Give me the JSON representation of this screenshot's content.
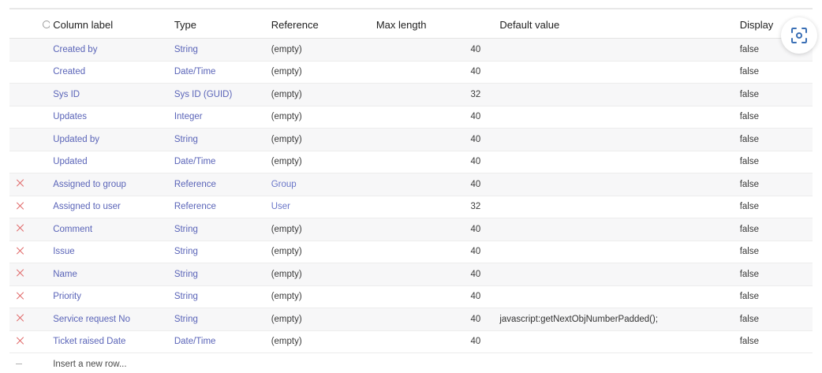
{
  "columns": {
    "label": "Column label",
    "type": "Type",
    "reference": "Reference",
    "max_length": "Max length",
    "default_value": "Default value",
    "display": "Display"
  },
  "icons": {
    "search": "search-icon",
    "delete": "x-icon",
    "insert": "minus-icon",
    "scan": "scan-icon"
  },
  "colors": {
    "link": "#5a64b8",
    "delete": "#e06a6a"
  },
  "rows": [
    {
      "deletable": false,
      "label": "Created by",
      "type": "String",
      "reference": "(empty)",
      "max_length": "40",
      "default_value": "",
      "display": "false"
    },
    {
      "deletable": false,
      "label": "Created",
      "type": "Date/Time",
      "reference": "(empty)",
      "max_length": "40",
      "default_value": "",
      "display": "false"
    },
    {
      "deletable": false,
      "label": "Sys ID",
      "type": "Sys ID (GUID)",
      "reference": "(empty)",
      "max_length": "32",
      "default_value": "",
      "display": "false"
    },
    {
      "deletable": false,
      "label": "Updates",
      "type": "Integer",
      "reference": "(empty)",
      "max_length": "40",
      "default_value": "",
      "display": "false"
    },
    {
      "deletable": false,
      "label": "Updated by",
      "type": "String",
      "reference": "(empty)",
      "max_length": "40",
      "default_value": "",
      "display": "false"
    },
    {
      "deletable": false,
      "label": "Updated",
      "type": "Date/Time",
      "reference": "(empty)",
      "max_length": "40",
      "default_value": "",
      "display": "false"
    },
    {
      "deletable": true,
      "label": "Assigned to group",
      "type": "Reference",
      "reference": "Group",
      "max_length": "40",
      "default_value": "",
      "display": "false"
    },
    {
      "deletable": true,
      "label": "Assigned to user",
      "type": "Reference",
      "reference": "User",
      "max_length": "32",
      "default_value": "",
      "display": "false"
    },
    {
      "deletable": true,
      "label": "Comment",
      "type": "String",
      "reference": "(empty)",
      "max_length": "40",
      "default_value": "",
      "display": "false"
    },
    {
      "deletable": true,
      "label": "Issue",
      "type": "String",
      "reference": "(empty)",
      "max_length": "40",
      "default_value": "",
      "display": "false"
    },
    {
      "deletable": true,
      "label": "Name",
      "type": "String",
      "reference": "(empty)",
      "max_length": "40",
      "default_value": "",
      "display": "false"
    },
    {
      "deletable": true,
      "label": "Priority",
      "type": "String",
      "reference": "(empty)",
      "max_length": "40",
      "default_value": "",
      "display": "false"
    },
    {
      "deletable": true,
      "label": "Service request No",
      "type": "String",
      "reference": "(empty)",
      "max_length": "40",
      "default_value": "javascript:getNextObjNumberPadded();",
      "display": "false"
    },
    {
      "deletable": true,
      "label": "Ticket raised Date",
      "type": "Date/Time",
      "reference": "(empty)",
      "max_length": "40",
      "default_value": "",
      "display": "false"
    }
  ],
  "insert_row": {
    "label": "Insert a new row..."
  }
}
